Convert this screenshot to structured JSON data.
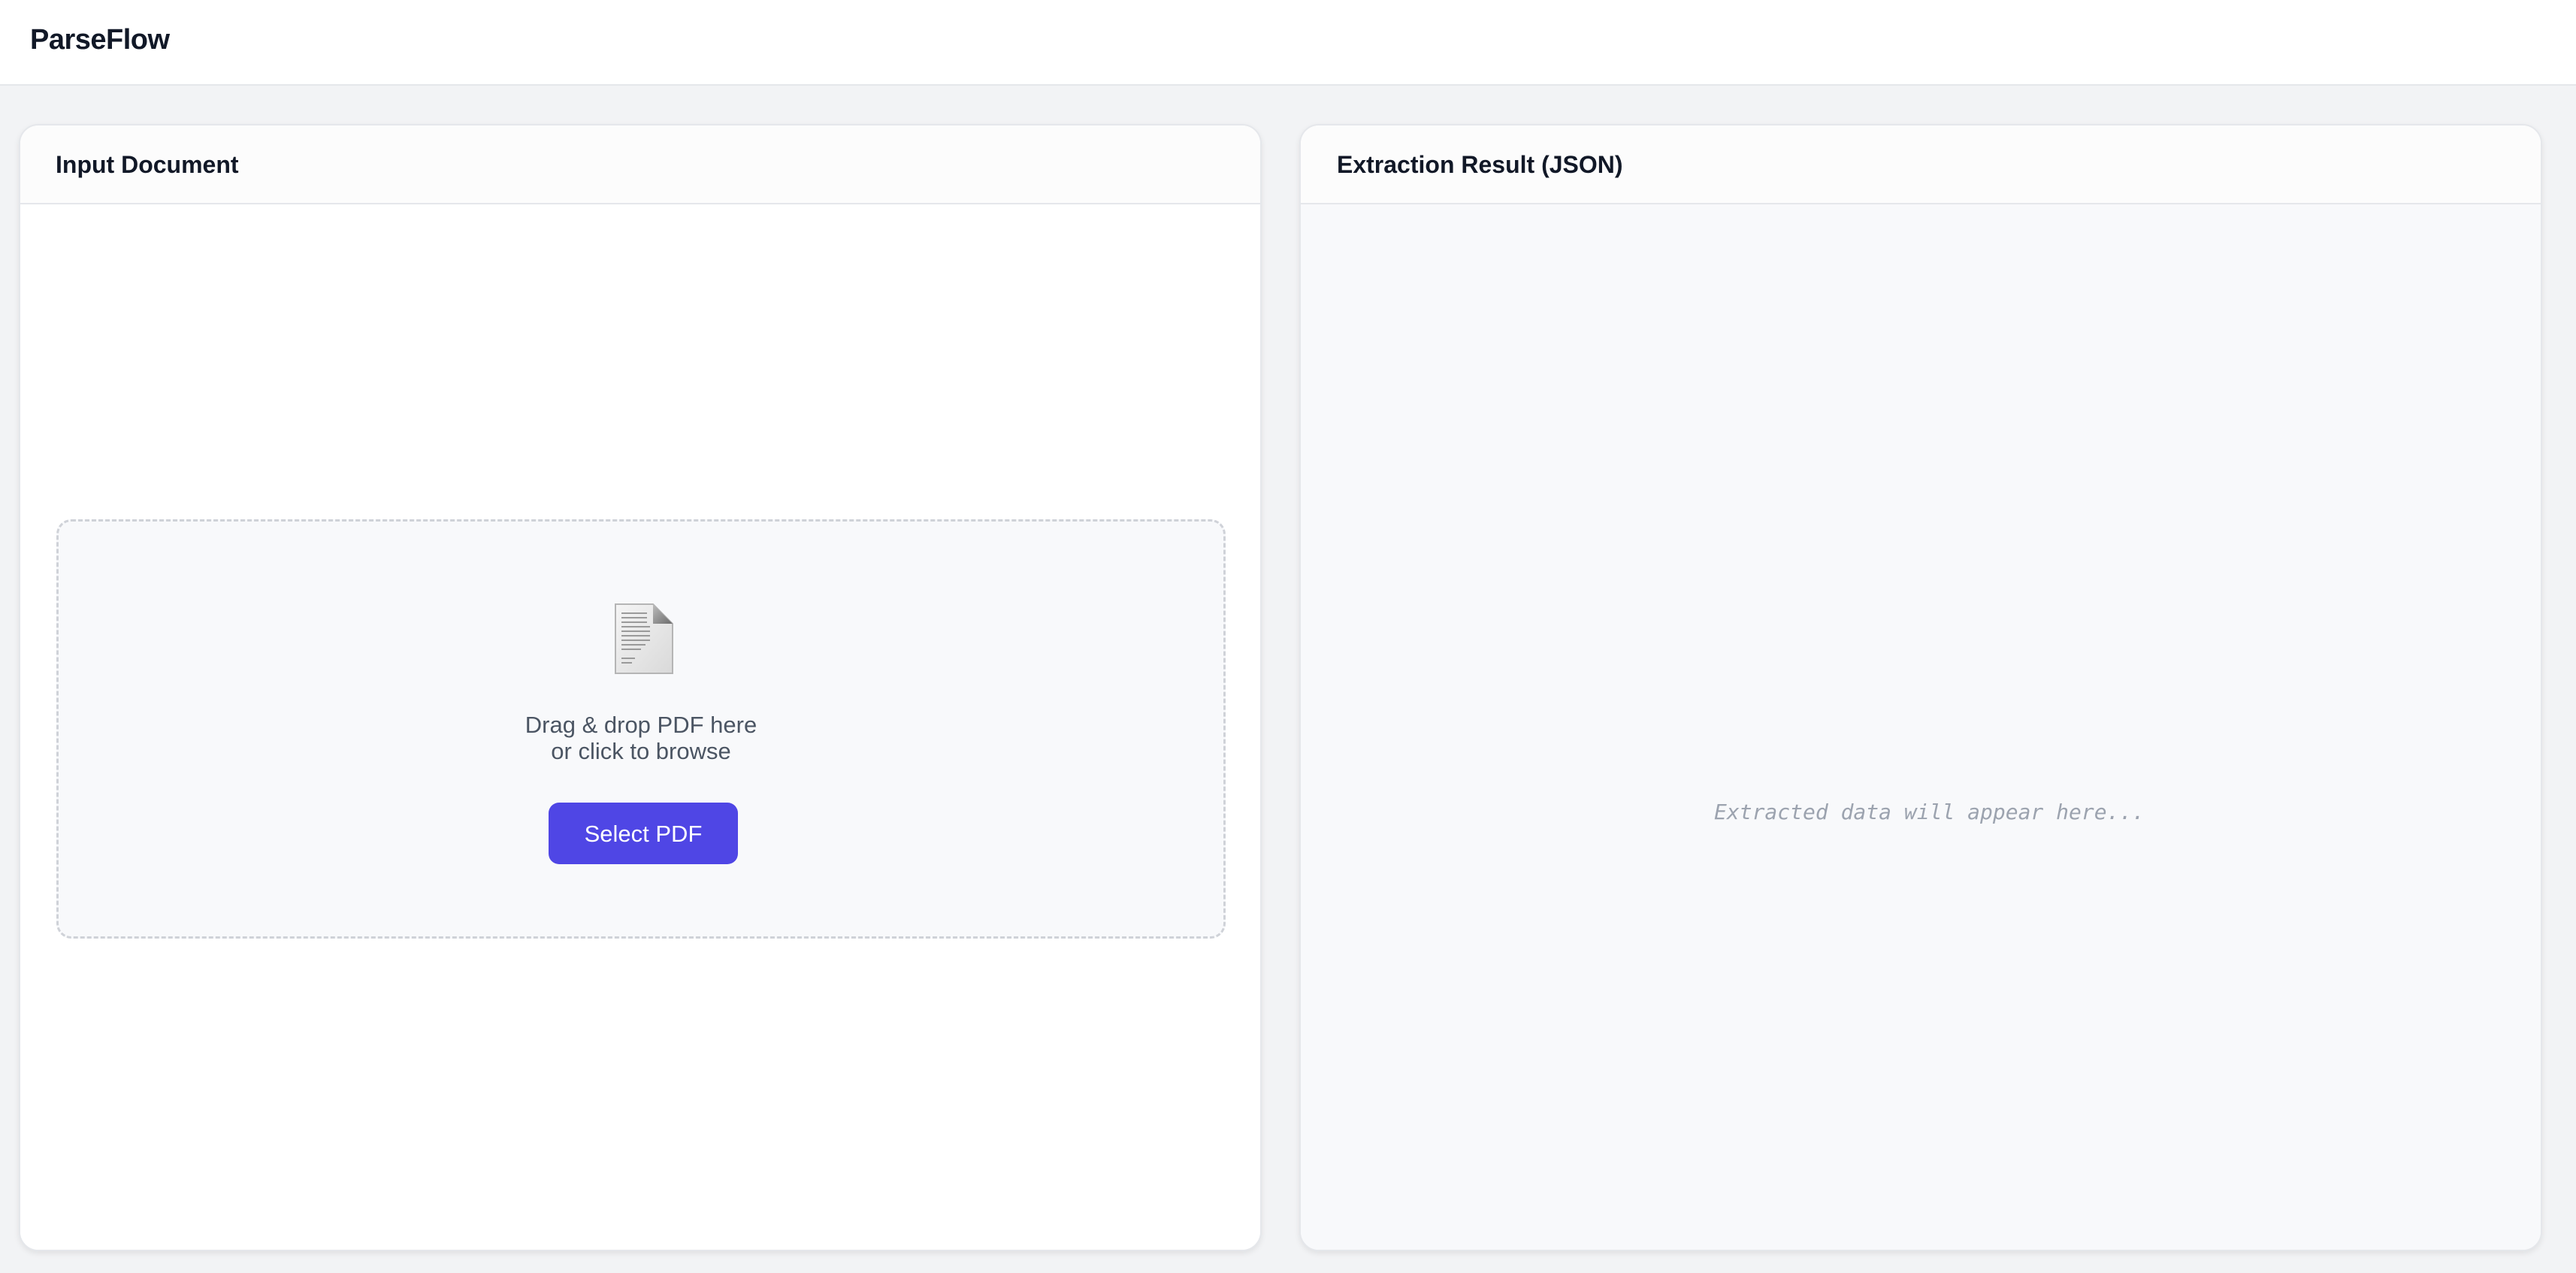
{
  "app": {
    "brand": "ParseFlow"
  },
  "input_panel": {
    "title": "Input Document",
    "dropzone": {
      "icon": "document-icon",
      "line1": "Drag & drop PDF here",
      "line2": "or click to browse",
      "button_label": "Select PDF"
    }
  },
  "result_panel": {
    "title": "Extraction Result (JSON)",
    "placeholder": "Extracted data will appear here..."
  },
  "colors": {
    "accent": "#4f46e5",
    "background": "#f2f3f5",
    "panel_border": "#e5e7eb",
    "dropzone_border": "#cfd2d8"
  }
}
